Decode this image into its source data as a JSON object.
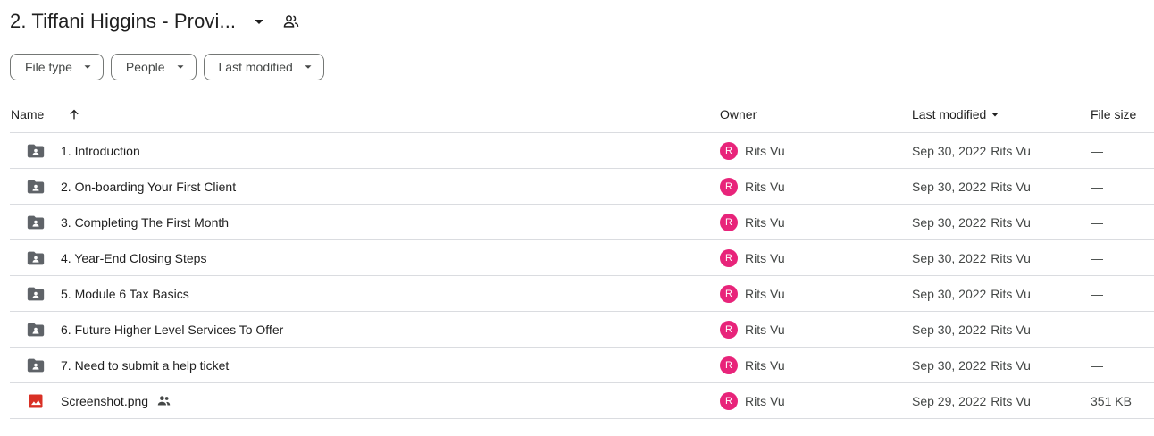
{
  "header": {
    "title": "2. Tiffani Higgins - Provi...",
    "caret_icon": "arrow-drop-down-icon",
    "share_icon": "shared-people-icon"
  },
  "filters": [
    {
      "label": "File type"
    },
    {
      "label": "People"
    },
    {
      "label": "Last modified"
    }
  ],
  "table": {
    "columns": {
      "name": "Name",
      "owner": "Owner",
      "last_modified": "Last modified",
      "file_size": "File size"
    },
    "rows": [
      {
        "icon": "shared-folder-icon",
        "name": "1. Introduction",
        "owner_initial": "R",
        "owner": "Rits Vu",
        "date": "Sep 30, 2022",
        "modified_by": "Rits Vu",
        "size": "—"
      },
      {
        "icon": "shared-folder-icon",
        "name": "2. On-boarding Your First Client",
        "owner_initial": "R",
        "owner": "Rits Vu",
        "date": "Sep 30, 2022",
        "modified_by": "Rits Vu",
        "size": "—"
      },
      {
        "icon": "shared-folder-icon",
        "name": "3. Completing The First Month",
        "owner_initial": "R",
        "owner": "Rits Vu",
        "date": "Sep 30, 2022",
        "modified_by": "Rits Vu",
        "size": "—"
      },
      {
        "icon": "shared-folder-icon",
        "name": "4. Year-End Closing Steps",
        "owner_initial": "R",
        "owner": "Rits Vu",
        "date": "Sep 30, 2022",
        "modified_by": "Rits Vu",
        "size": "—"
      },
      {
        "icon": "shared-folder-icon",
        "name": "5. Module 6 Tax Basics",
        "owner_initial": "R",
        "owner": "Rits Vu",
        "date": "Sep 30, 2022",
        "modified_by": "Rits Vu",
        "size": "—"
      },
      {
        "icon": "shared-folder-icon",
        "name": "6. Future Higher Level Services To Offer",
        "owner_initial": "R",
        "owner": "Rits Vu",
        "date": "Sep 30, 2022",
        "modified_by": "Rits Vu",
        "size": "—"
      },
      {
        "icon": "shared-folder-icon",
        "name": "7. Need to submit a help ticket",
        "owner_initial": "R",
        "owner": "Rits Vu",
        "date": "Sep 30, 2022",
        "modified_by": "Rits Vu",
        "size": "—"
      },
      {
        "icon": "image-file-icon",
        "name": "Screenshot.png",
        "shared": true,
        "owner_initial": "R",
        "owner": "Rits Vu",
        "date": "Sep 29, 2022",
        "modified_by": "Rits Vu",
        "size": "351 KB"
      }
    ]
  },
  "colors": {
    "avatar": "#e8247a",
    "image_icon": "#d93025",
    "folder_icon": "#5f6368",
    "border": "#dadce0"
  }
}
